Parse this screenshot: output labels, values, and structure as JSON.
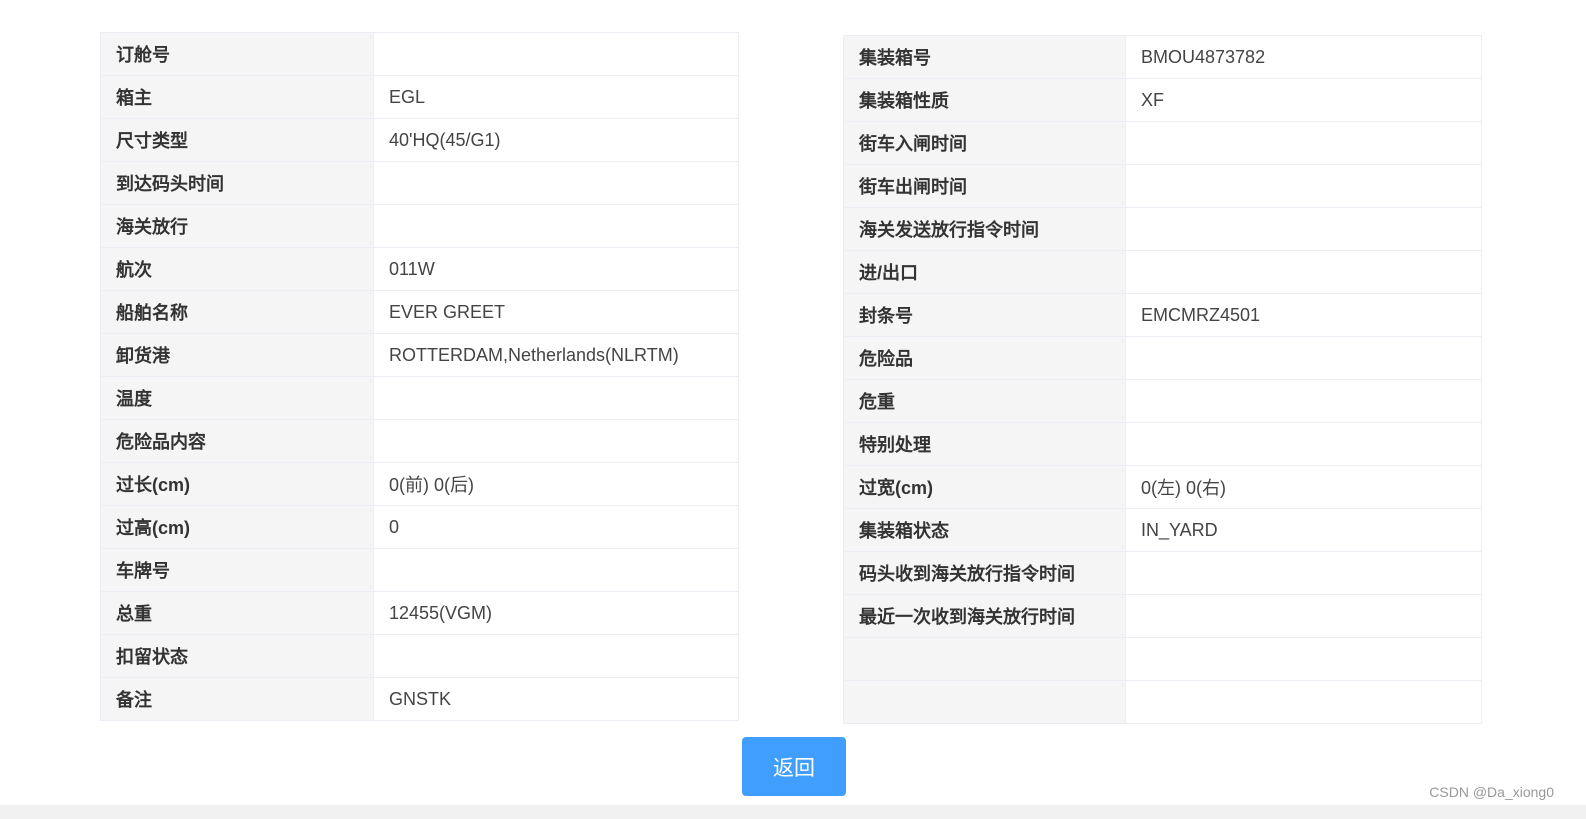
{
  "left_table": [
    {
      "label": "订舱号",
      "value": ""
    },
    {
      "label": "箱主",
      "value": "EGL"
    },
    {
      "label": "尺寸类型",
      "value": "40'HQ(45/G1)"
    },
    {
      "label": "到达码头时间",
      "value": ""
    },
    {
      "label": "海关放行",
      "value": ""
    },
    {
      "label": "航次",
      "value": "011W"
    },
    {
      "label": "船舶名称",
      "value": "EVER GREET"
    },
    {
      "label": "卸货港",
      "value": "ROTTERDAM,Netherlands(NLRTM)"
    },
    {
      "label": "温度",
      "value": ""
    },
    {
      "label": "危险品内容",
      "value": ""
    },
    {
      "label": "过长(cm)",
      "value": "0(前) 0(后)"
    },
    {
      "label": "过高(cm)",
      "value": "0"
    },
    {
      "label": "车牌号",
      "value": ""
    },
    {
      "label": "总重",
      "value": "12455(VGM)"
    },
    {
      "label": "扣留状态",
      "value": ""
    },
    {
      "label": "备注",
      "value": "GNSTK"
    }
  ],
  "right_table": [
    {
      "label": "集装箱号",
      "value": "BMOU4873782"
    },
    {
      "label": "集装箱性质",
      "value": "XF"
    },
    {
      "label": "街车入闸时间",
      "value": ""
    },
    {
      "label": "街车出闸时间",
      "value": ""
    },
    {
      "label": "海关发送放行指令时间",
      "value": ""
    },
    {
      "label": "进/出口",
      "value": ""
    },
    {
      "label": "封条号",
      "value": "EMCMRZ4501"
    },
    {
      "label": "危险品",
      "value": ""
    },
    {
      "label": "危重",
      "value": ""
    },
    {
      "label": "特别处理",
      "value": ""
    },
    {
      "label": "过宽(cm)",
      "value": "0(左) 0(右)"
    },
    {
      "label": "集装箱状态",
      "value": "IN_YARD"
    },
    {
      "label": "码头收到海关放行指令时间",
      "value": ""
    },
    {
      "label": "最近一次收到海关放行时间",
      "value": ""
    },
    {
      "label": "",
      "value": ""
    },
    {
      "label": "",
      "value": ""
    }
  ],
  "actions": {
    "back_label": "返回"
  },
  "watermark": "CSDN @Da_xiong0",
  "colors": {
    "accent": "#409eff",
    "label_bg": "#f5f5f5",
    "border": "#ebeef5"
  }
}
